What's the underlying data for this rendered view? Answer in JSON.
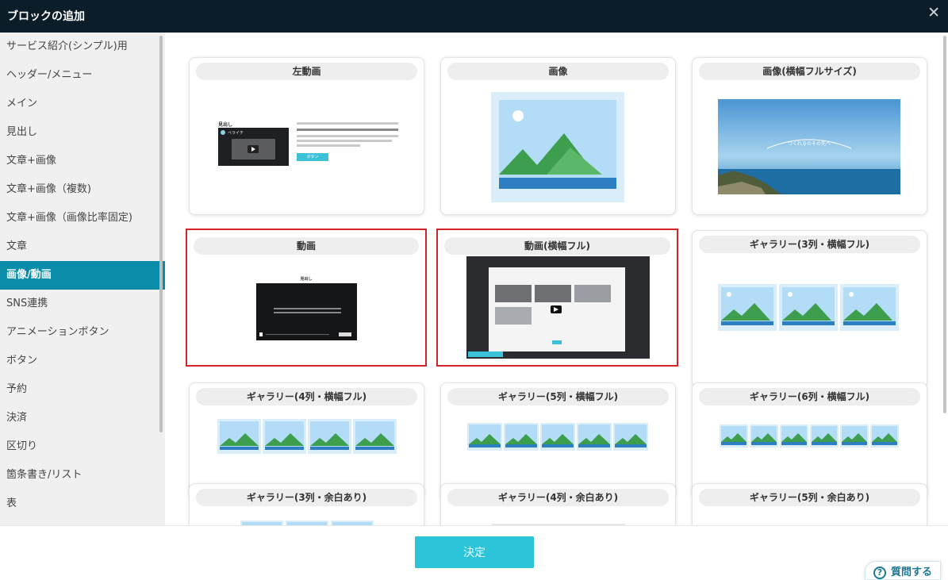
{
  "header": {
    "title": "ブロックの追加",
    "close_icon": "close-icon"
  },
  "sidebar": {
    "items": [
      {
        "label": "サービス紹介(シンプル)用"
      },
      {
        "label": "ヘッダー/メニュー"
      },
      {
        "label": "メイン"
      },
      {
        "label": "見出し"
      },
      {
        "label": "文章+画像"
      },
      {
        "label": "文章+画像（複数)"
      },
      {
        "label": "文章+画像（画像比率固定)"
      },
      {
        "label": "文章"
      },
      {
        "label": "画像/動画",
        "active": true
      },
      {
        "label": "SNS連携"
      },
      {
        "label": "アニメーションボタン"
      },
      {
        "label": "ボタン"
      },
      {
        "label": "予約"
      },
      {
        "label": "決済"
      },
      {
        "label": "区切り"
      },
      {
        "label": "箇条書き/リスト"
      },
      {
        "label": "表"
      }
    ]
  },
  "cards": [
    {
      "title": "左動画",
      "thumb": {
        "heading": "見出し",
        "button": "ボタン",
        "video_title": "ペライチ"
      }
    },
    {
      "title": "画像"
    },
    {
      "title": "画像(横幅フルサイズ)",
      "thumb": {
        "banner": "つくれるのその先へ"
      }
    },
    {
      "title": "動画",
      "selected": true,
      "thumb": {
        "heading": "見出し"
      }
    },
    {
      "title": "動画(横幅フル)",
      "selected": true
    },
    {
      "title": "ギャラリー(3列・横幅フル)"
    },
    {
      "title": "ギャラリー(4列・横幅フル)"
    },
    {
      "title": "ギャラリー(5列・横幅フル)"
    },
    {
      "title": "ギャラリー(6列・横幅フル)"
    },
    {
      "title": "ギャラリー(3列・余白あり)"
    },
    {
      "title": "ギャラリー(4列・余白あり)"
    },
    {
      "title": "ギャラリー(5列・余白あり)"
    }
  ],
  "footer": {
    "confirm_label": "決定"
  },
  "help": {
    "label": "質問する",
    "icon": "question-icon"
  },
  "colors": {
    "header_bg": "#0a1d29",
    "active_item": "#0a8ca8",
    "confirm": "#2bc4d8",
    "selected_border": "#d3242a"
  }
}
